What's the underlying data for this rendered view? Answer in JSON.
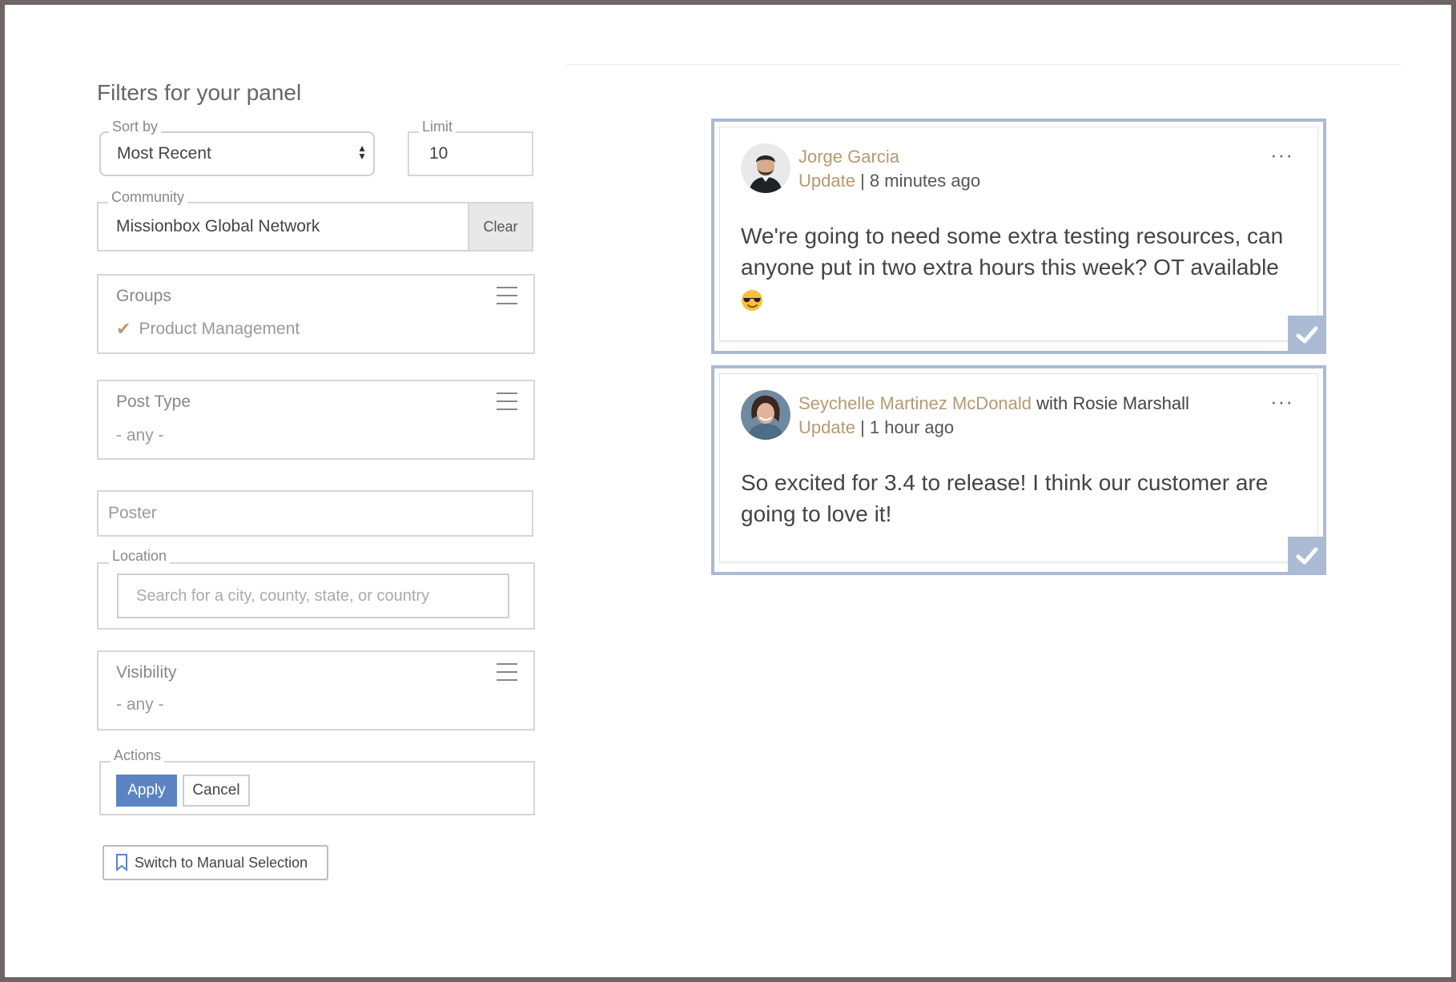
{
  "filters": {
    "title": "Filters for your panel",
    "sort_by": {
      "label": "Sort by",
      "value": "Most Recent"
    },
    "limit": {
      "label": "Limit",
      "value": "10"
    },
    "community": {
      "label": "Community",
      "value": "Missionbox Global Network",
      "clear_label": "Clear"
    },
    "groups": {
      "title": "Groups",
      "selected": "Product Management"
    },
    "post_type": {
      "title": "Post Type",
      "value": "- any -"
    },
    "poster": {
      "placeholder": "Poster"
    },
    "location": {
      "label": "Location",
      "placeholder": "Search for a city, county, state, or country"
    },
    "visibility": {
      "title": "Visibility",
      "value": "- any -"
    },
    "actions": {
      "label": "Actions",
      "apply_label": "Apply",
      "cancel_label": "Cancel"
    },
    "switch_label": "Switch to Manual Selection"
  },
  "posts": [
    {
      "author": "Jorge Garcia",
      "with_text": "",
      "type": "Update",
      "time": " | 8 minutes ago",
      "body": "We're going to need some extra testing resources, can anyone put in two extra hours this week? OT available",
      "emoji": "sunglasses"
    },
    {
      "author": "Seychelle Martinez McDonald",
      "with_text": " with Rosie Marshall",
      "type": "Update",
      "time": " | 1 hour ago",
      "body": "So excited for 3.4 to release! I think our customer are going to love it!"
    }
  ],
  "colors": {
    "accent_gold": "#b49a73",
    "apply_blue": "#5b83c2",
    "card_border": "#aabbd3"
  }
}
